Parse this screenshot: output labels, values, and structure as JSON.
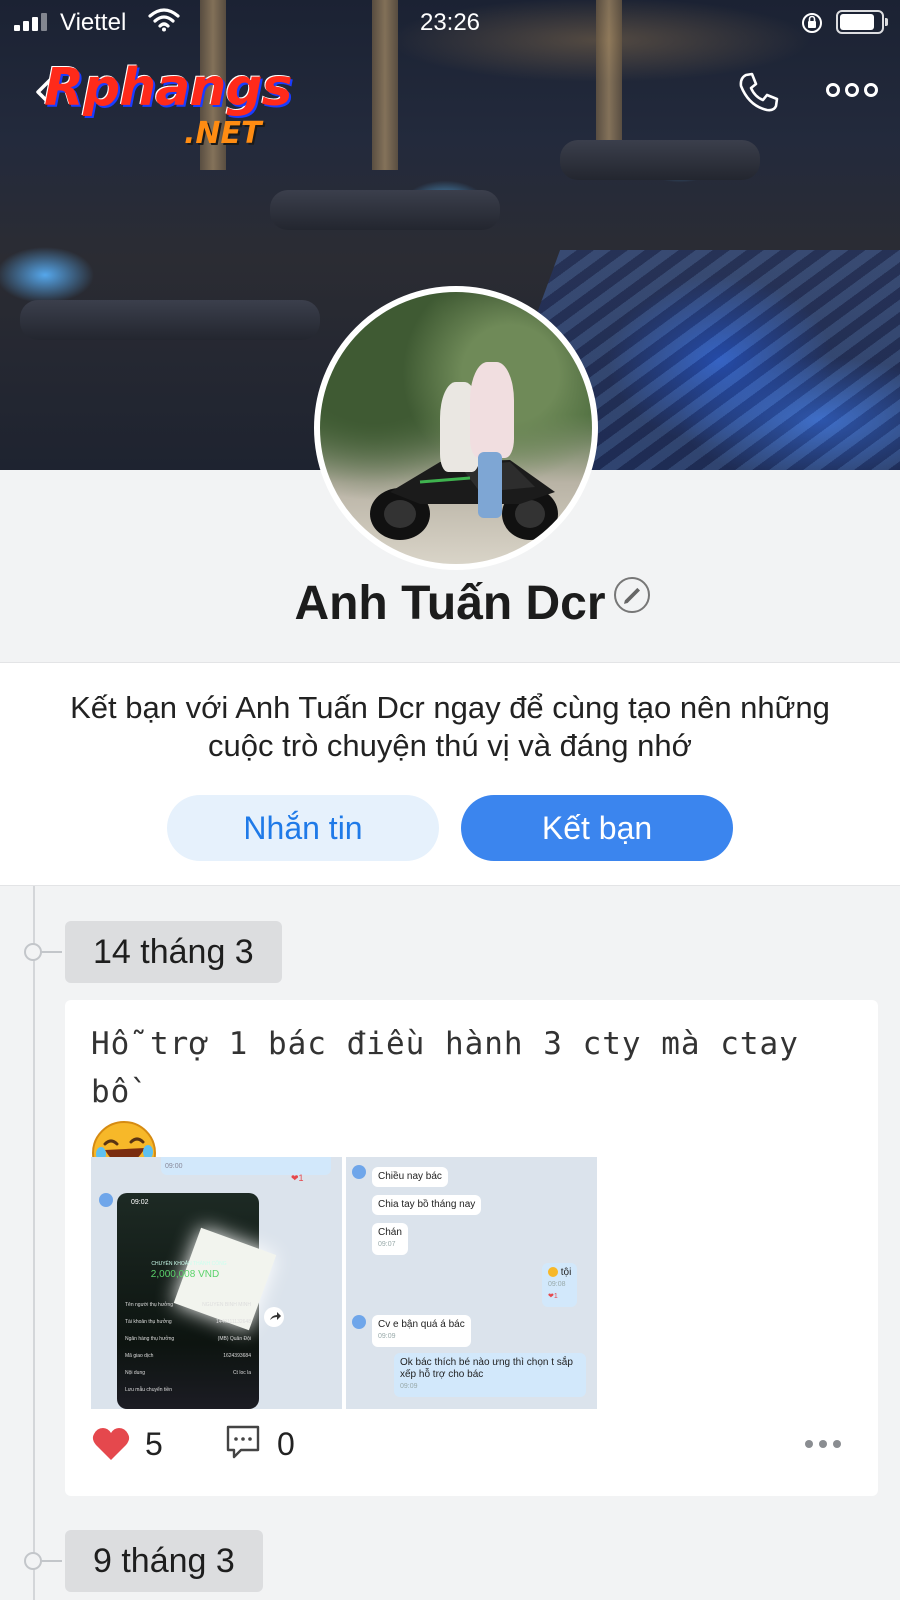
{
  "status_bar": {
    "carrier": "Viettel",
    "time": "23:26"
  },
  "watermark": {
    "main": "Rphangs",
    "sub": ".NET"
  },
  "header": {
    "back_icon": "chevron-left-icon",
    "call_icon": "phone-icon",
    "more_icon": "more-horizontal-icon"
  },
  "profile": {
    "name": "Anh Tuấn Dcr",
    "edit_icon": "pencil-icon"
  },
  "friend_card": {
    "prompt": "Kết bạn với Anh Tuấn Dcr ngay để cùng tạo nên những cuộc trò chuyện thú vị và đáng nhớ",
    "message_label": "Nhắn tin",
    "add_friend_label": "Kết bạn"
  },
  "timeline": [
    {
      "date": "14 tháng 3",
      "caption": "Hỗ trợ 1 bác điều hành 3 cty mà ctay bồ",
      "likes": "5",
      "comments": "0",
      "photo1": {
        "time_top": "09:00",
        "reaction": "❤1",
        "phone_time": "09:02",
        "status": "CHUYỂN KHOẢN THÀNH CÔNG",
        "amount": "2,000,008 VND",
        "rows": [
          {
            "label": "Tên người thụ hưởng",
            "value": "NGUYEN BINH MINH"
          },
          {
            "label": "Tài khoản thụ hưởng",
            "value": "1440111132648"
          },
          {
            "label": "Ngân hàng thụ hưởng",
            "value": "(MB) Quân Đội"
          },
          {
            "label": "Mã giao dịch",
            "value": "1624393684"
          },
          {
            "label": "Nội dung",
            "value": "Ct loc la"
          },
          {
            "label": "Lưu mẫu chuyển tiền",
            "value": ""
          }
        ]
      },
      "photo2": {
        "messages": [
          {
            "text": "Chiều nay bác",
            "time": ""
          },
          {
            "text": "Chia tay bồ tháng nay",
            "time": ""
          },
          {
            "text": "Chán",
            "time": "09:07"
          },
          {
            "text": "tội",
            "time": "09:08",
            "reaction": "❤1"
          },
          {
            "text": "Cv  e bận quá á bác",
            "time": "09:09"
          },
          {
            "text": "Ok bác thích bé nào ưng thì chọn t sắp xếp hỗ trợ cho bác",
            "time": "09:09"
          }
        ]
      }
    },
    {
      "date": "9 tháng 3"
    }
  ],
  "colors": {
    "primary": "#3b85ee",
    "secondary_bg": "#e6f1fc",
    "like": "#e5484d"
  }
}
